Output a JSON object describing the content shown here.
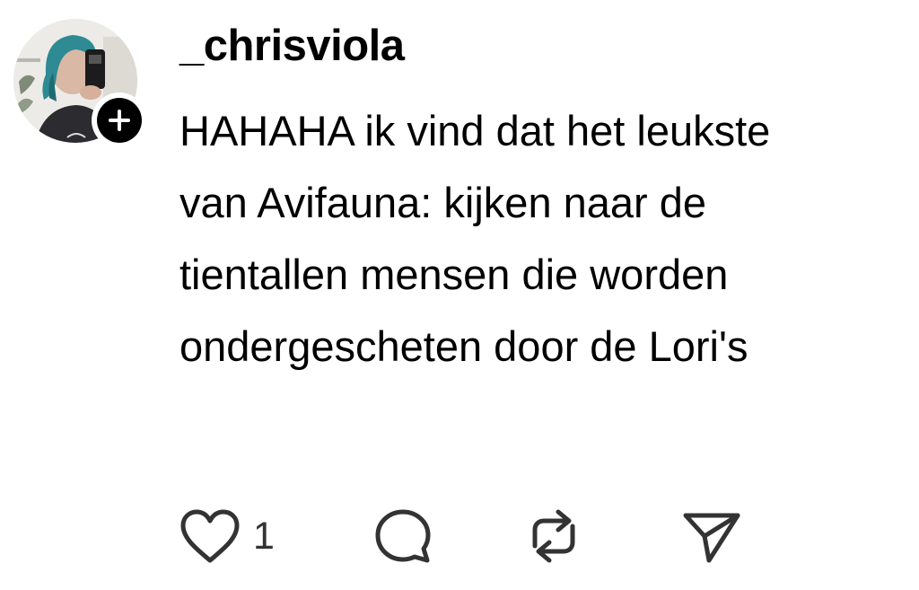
{
  "post": {
    "username": "_chrisviola",
    "text": "HAHAHA ik vind dat het leukste\nvan Avifauna: kijken naar de\ntientallen mensen die worden\nondergescheten door de Lori's"
  },
  "avatar": {
    "icon": "profile-photo",
    "follow_icon": "plus-icon"
  },
  "actions": {
    "like": {
      "icon": "heart-icon",
      "count": "1"
    },
    "comment": {
      "icon": "comment-icon"
    },
    "repost": {
      "icon": "repost-icon"
    },
    "share": {
      "icon": "send-icon"
    }
  },
  "colors": {
    "text": "#000000",
    "icon": "#333333",
    "background": "#ffffff"
  }
}
